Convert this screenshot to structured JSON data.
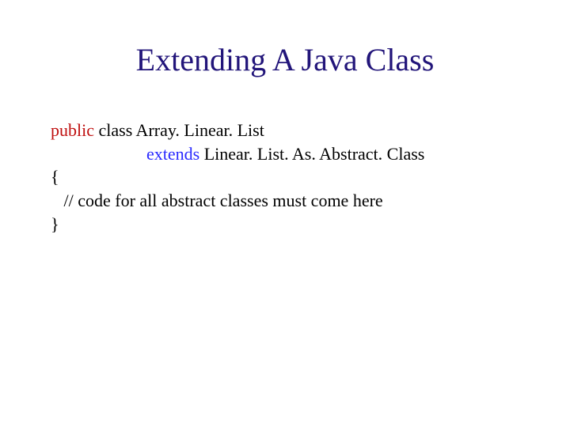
{
  "title": "Extending A Java Class",
  "code": {
    "kw_public": "public",
    "rest_line1": " class Array. Linear. List",
    "indent_line2": "                      ",
    "kw_extends": "extends",
    "rest_line2": " Linear. List. As. Abstract. Class",
    "line3": "{",
    "line4": "   // code for all abstract classes must come here",
    "line5": "}"
  }
}
